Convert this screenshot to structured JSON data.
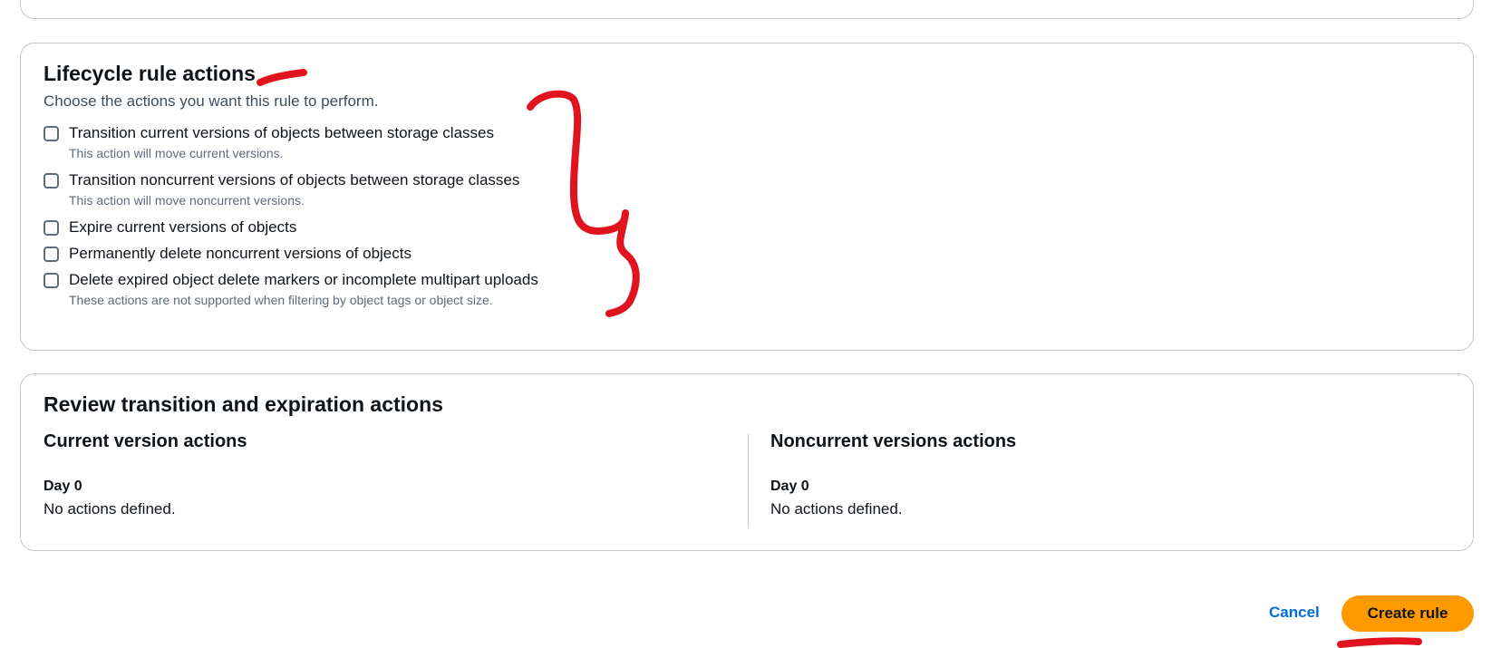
{
  "lifecycle_actions": {
    "title": "Lifecycle rule actions",
    "description": "Choose the actions you want this rule to perform.",
    "options": [
      {
        "label": "Transition current versions of objects between storage classes",
        "hint": "This action will move current versions.",
        "checked": false
      },
      {
        "label": "Transition noncurrent versions of objects between storage classes",
        "hint": "This action will move noncurrent versions.",
        "checked": false
      },
      {
        "label": "Expire current versions of objects",
        "hint": "",
        "checked": false
      },
      {
        "label": "Permanently delete noncurrent versions of objects",
        "hint": "",
        "checked": false
      },
      {
        "label": "Delete expired object delete markers or incomplete multipart uploads",
        "hint": "These actions are not supported when filtering by object tags or object size.",
        "checked": false
      }
    ]
  },
  "review": {
    "title": "Review transition and expiration actions",
    "current": {
      "title": "Current version actions",
      "day_label": "Day 0",
      "text": "No actions defined."
    },
    "noncurrent": {
      "title": "Noncurrent versions actions",
      "day_label": "Day 0",
      "text": "No actions defined."
    }
  },
  "footer": {
    "cancel_label": "Cancel",
    "create_label": "Create rule"
  },
  "colors": {
    "primary_button": "#ff9900",
    "link": "#006ce0",
    "annotation_marker": "#e0141e"
  }
}
